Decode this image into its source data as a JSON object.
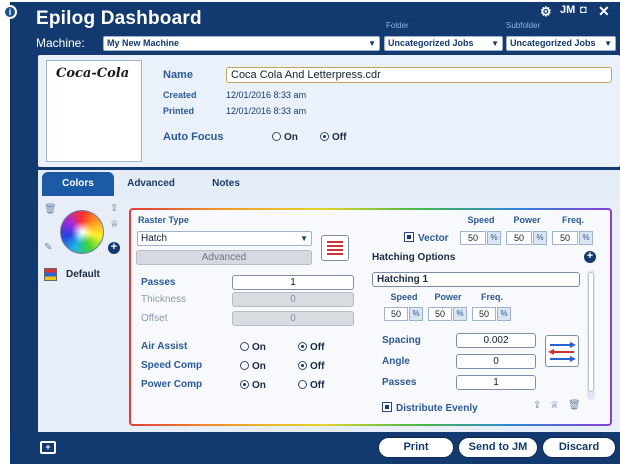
{
  "app": {
    "title": "Epilog Dashboard"
  },
  "header": {
    "folder_label": "Folder",
    "subfolder_label": "Subfolder",
    "machine_label": "Machine:",
    "machine_value": "My New Machine",
    "folder_value": "Uncategorized Jobs",
    "subfolder_value": "Uncategorized Jobs"
  },
  "job": {
    "thumbnail_text": "Coca-Cola",
    "name_label": "Name",
    "name_value": "Coca Cola And Letterpress.cdr",
    "created_label": "Created",
    "created_value": "12/01/2016 8:33 am",
    "printed_label": "Printed",
    "printed_value": "12/01/2016 8:33 am",
    "autofocus_label": "Auto Focus",
    "autofocus_on": "On",
    "autofocus_off": "Off",
    "autofocus_selected": "Off"
  },
  "tabs": [
    {
      "label": "Colors",
      "active": true
    },
    {
      "label": "Advanced",
      "active": false
    },
    {
      "label": "Notes",
      "active": false
    }
  ],
  "colors": {
    "default_label": "Default"
  },
  "raster": {
    "type_label": "Raster Type",
    "type_value": "Hatch",
    "advanced_button": "Advanced",
    "passes_label": "Passes",
    "passes_value": "1",
    "thickness_label": "Thickness",
    "thickness_value": "0",
    "offset_label": "Offset",
    "offset_value": "0",
    "air_assist_label": "Air Assist",
    "speed_comp_label": "Speed Comp",
    "power_comp_label": "Power Comp",
    "on": "On",
    "off": "Off",
    "air_assist_selected": "Off",
    "speed_comp_selected": "Off",
    "power_comp_selected": "On"
  },
  "vector": {
    "label": "Vector",
    "checked": true,
    "headers": [
      "Speed",
      "Power",
      "Freq."
    ],
    "values": [
      "50",
      "50",
      "50"
    ],
    "unit": "%"
  },
  "hatching": {
    "options_label": "Hatching Options",
    "name_value": "Hatching 1",
    "headers": [
      "Speed",
      "Power",
      "Freq."
    ],
    "values": [
      "50",
      "50",
      "50"
    ],
    "unit": "%",
    "spacing_label": "Spacing",
    "spacing_value": "0.002",
    "angle_label": "Angle",
    "angle_value": "0",
    "passes_label": "Passes",
    "passes_value": "1",
    "distribute_label": "Distribute Evenly",
    "distribute_checked": true
  },
  "footer": {
    "print_button": "Print",
    "send_button": "Send to JM",
    "discard_button": "Discard"
  },
  "colors_accent": {
    "brand": "#123a70",
    "tab_active": "#1c5aa5"
  }
}
